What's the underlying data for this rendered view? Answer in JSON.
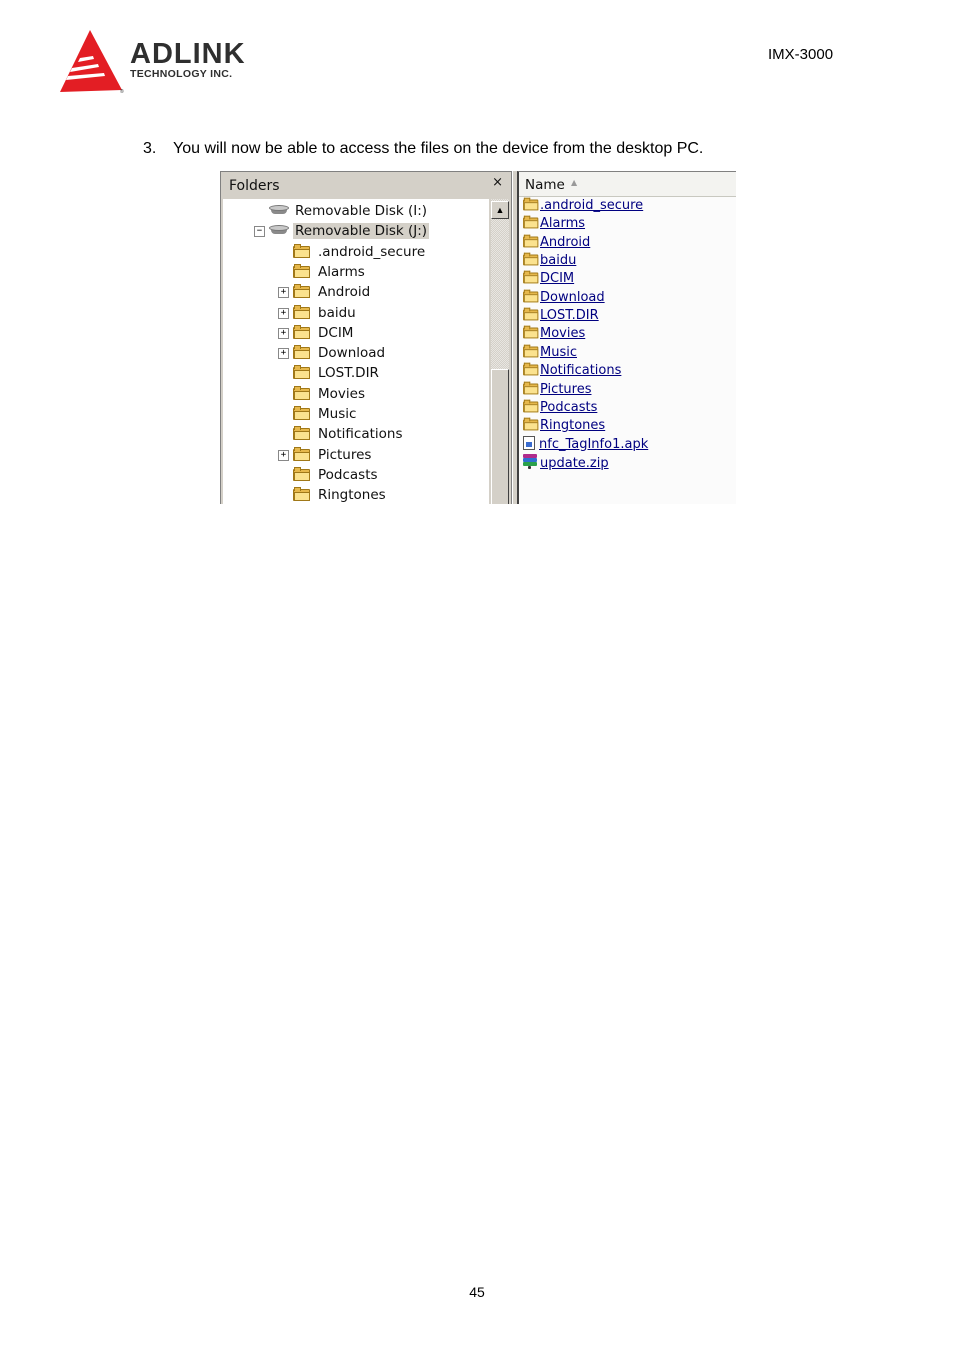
{
  "header": {
    "logo_name": "ADLINK",
    "logo_subtitle": "TECHNOLOGY INC.",
    "model": "IMX-3000"
  },
  "content": {
    "step_number": "3.",
    "step_text": "You will now be able to access the files on the device from the desktop PC."
  },
  "screenshot": {
    "folders_pane": {
      "title": "Folders",
      "close_glyph": "×",
      "scroll_up_glyph": "▲",
      "tree": [
        {
          "label": "Removable Disk (I:)",
          "icon": "drive-icon",
          "expander": "",
          "level": 0,
          "selected": false
        },
        {
          "label": "Removable Disk (J:)",
          "icon": "drive-icon",
          "expander": "−",
          "level": 0,
          "selected": true
        },
        {
          "label": ".android_secure",
          "icon": "folder-icon",
          "expander": "",
          "level": 1
        },
        {
          "label": "Alarms",
          "icon": "folder-icon",
          "expander": "",
          "level": 1
        },
        {
          "label": "Android",
          "icon": "folder-icon",
          "expander": "+",
          "level": 1
        },
        {
          "label": "baidu",
          "icon": "folder-icon",
          "expander": "+",
          "level": 1
        },
        {
          "label": "DCIM",
          "icon": "folder-icon",
          "expander": "+",
          "level": 1
        },
        {
          "label": "Download",
          "icon": "folder-icon",
          "expander": "+",
          "level": 1
        },
        {
          "label": "LOST.DIR",
          "icon": "folder-icon",
          "expander": "",
          "level": 1
        },
        {
          "label": "Movies",
          "icon": "folder-icon",
          "expander": "",
          "level": 1
        },
        {
          "label": "Music",
          "icon": "folder-icon",
          "expander": "",
          "level": 1
        },
        {
          "label": "Notifications",
          "icon": "folder-icon",
          "expander": "",
          "level": 1
        },
        {
          "label": "Pictures",
          "icon": "folder-icon",
          "expander": "+",
          "level": 1
        },
        {
          "label": "Podcasts",
          "icon": "folder-icon",
          "expander": "",
          "level": 1
        },
        {
          "label": "Ringtones",
          "icon": "folder-icon",
          "expander": "",
          "level": 1
        }
      ]
    },
    "files_pane": {
      "column_header": "Name",
      "sort_glyph": "▲",
      "items": [
        {
          "label": ".android_secure",
          "icon": "folder-icon"
        },
        {
          "label": "Alarms",
          "icon": "folder-icon"
        },
        {
          "label": "Android",
          "icon": "folder-icon"
        },
        {
          "label": "baidu",
          "icon": "folder-icon"
        },
        {
          "label": "DCIM",
          "icon": "folder-icon"
        },
        {
          "label": "Download",
          "icon": "folder-icon"
        },
        {
          "label": "LOST.DIR",
          "icon": "folder-icon"
        },
        {
          "label": "Movies",
          "icon": "folder-icon"
        },
        {
          "label": "Music",
          "icon": "folder-icon"
        },
        {
          "label": "Notifications",
          "icon": "folder-icon"
        },
        {
          "label": "Pictures",
          "icon": "folder-icon"
        },
        {
          "label": "Podcasts",
          "icon": "folder-icon"
        },
        {
          "label": "Ringtones",
          "icon": "folder-icon"
        },
        {
          "label": "nfc_TagInfo1.apk",
          "icon": "apk-file-icon"
        },
        {
          "label": "update.zip",
          "icon": "zip-archive-icon"
        }
      ]
    }
  },
  "footer": {
    "page_number": "45"
  },
  "colors": {
    "logo_red": "#e31e24",
    "logo_text": "#2f2f2f",
    "link_blue": "#000080",
    "panel_gray": "#d4d0c8"
  }
}
